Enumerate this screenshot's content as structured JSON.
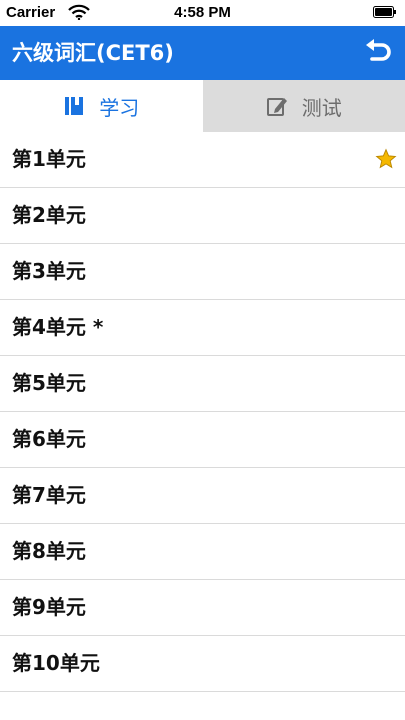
{
  "status_bar": {
    "carrier": "Carrier",
    "time": "4:58 PM"
  },
  "nav": {
    "title": "六级词汇(CET6)",
    "back_icon": "undo-arrow-icon"
  },
  "tabs": [
    {
      "label": "学习",
      "icon": "book-icon",
      "selected": true
    },
    {
      "label": "测试",
      "icon": "pencil-edit-icon",
      "selected": false
    }
  ],
  "units": [
    {
      "label": "第1单元",
      "starred": true
    },
    {
      "label": "第2单元"
    },
    {
      "label": "第3单元"
    },
    {
      "label": "第4单元 *"
    },
    {
      "label": "第5单元"
    },
    {
      "label": "第6单元"
    },
    {
      "label": "第7单元"
    },
    {
      "label": "第8单元"
    },
    {
      "label": "第9单元"
    },
    {
      "label": "第10单元"
    }
  ],
  "colors": {
    "accent": "#1a73e0",
    "tab_inactive_bg": "#dcdcdc",
    "star": "#f5b800"
  }
}
